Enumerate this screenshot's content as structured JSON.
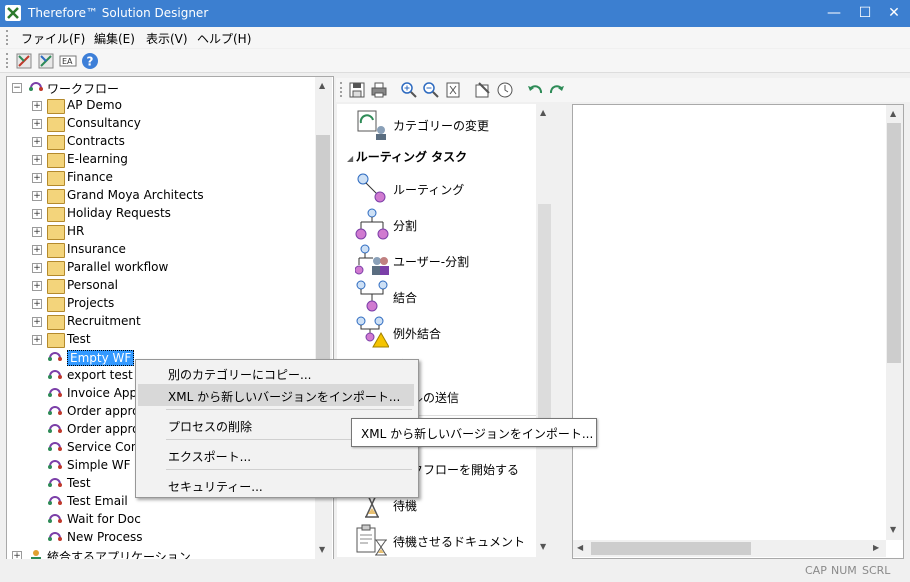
{
  "window": {
    "title": "Therefore™ Solution Designer",
    "minimize": "—",
    "maximize": "☐",
    "close": "✕"
  },
  "menu": [
    "ファイル(F)",
    "編集(E)",
    "表示(V)",
    "ヘルプ(H)"
  ],
  "toolbar": {
    "icons": [
      "designer-icon",
      "designer2-icon",
      "text-icon",
      "help-icon"
    ]
  },
  "tree": {
    "root_label": "ワークフロー",
    "folders": [
      "AP Demo",
      "Consultancy",
      "Contracts",
      "E-learning",
      "Finance",
      "Grand Moya Architects",
      "Holiday Requests",
      "HR",
      "Insurance",
      "Parallel workflow",
      "Personal",
      "Projects",
      "Recruitment",
      "Test"
    ],
    "processes": [
      "Empty WF",
      "export test",
      "Invoice Appr",
      "Order approv",
      "Order approv",
      "Service Contr",
      "Simple WF",
      "Test",
      "Test Email",
      "Wait for Doc",
      "New Process"
    ],
    "bottom_label": "統合するアプリケーション"
  },
  "palette": {
    "items_top": [
      {
        "label": "カテゴリーの変更"
      }
    ],
    "section_routing": "ルーティング タスク",
    "routing_items": [
      {
        "label": "ルーティング"
      },
      {
        "label": "分割"
      },
      {
        "label": "ユーザー-分割"
      },
      {
        "label": "結合"
      },
      {
        "label": "例外結合"
      }
    ],
    "section_partial": "ク",
    "mail_partial": "ルの送信",
    "start_partial": "クフローを開始する",
    "items_bottom": [
      {
        "label": "待機"
      },
      {
        "label": "待機させるドキュメント"
      }
    ]
  },
  "context_menu": {
    "items": [
      "別のカテゴリーにコピー...",
      "XML から新しいバージョンをインポート...",
      "プロセスの削除",
      "エクスポート...",
      "セキュリティー..."
    ],
    "hover_index": 1
  },
  "tooltip": {
    "text": "XML から新しいバージョンをインポート..."
  },
  "statusbar": {
    "cap": "CAP",
    "num": "NUM",
    "scrl": "SCRL"
  }
}
